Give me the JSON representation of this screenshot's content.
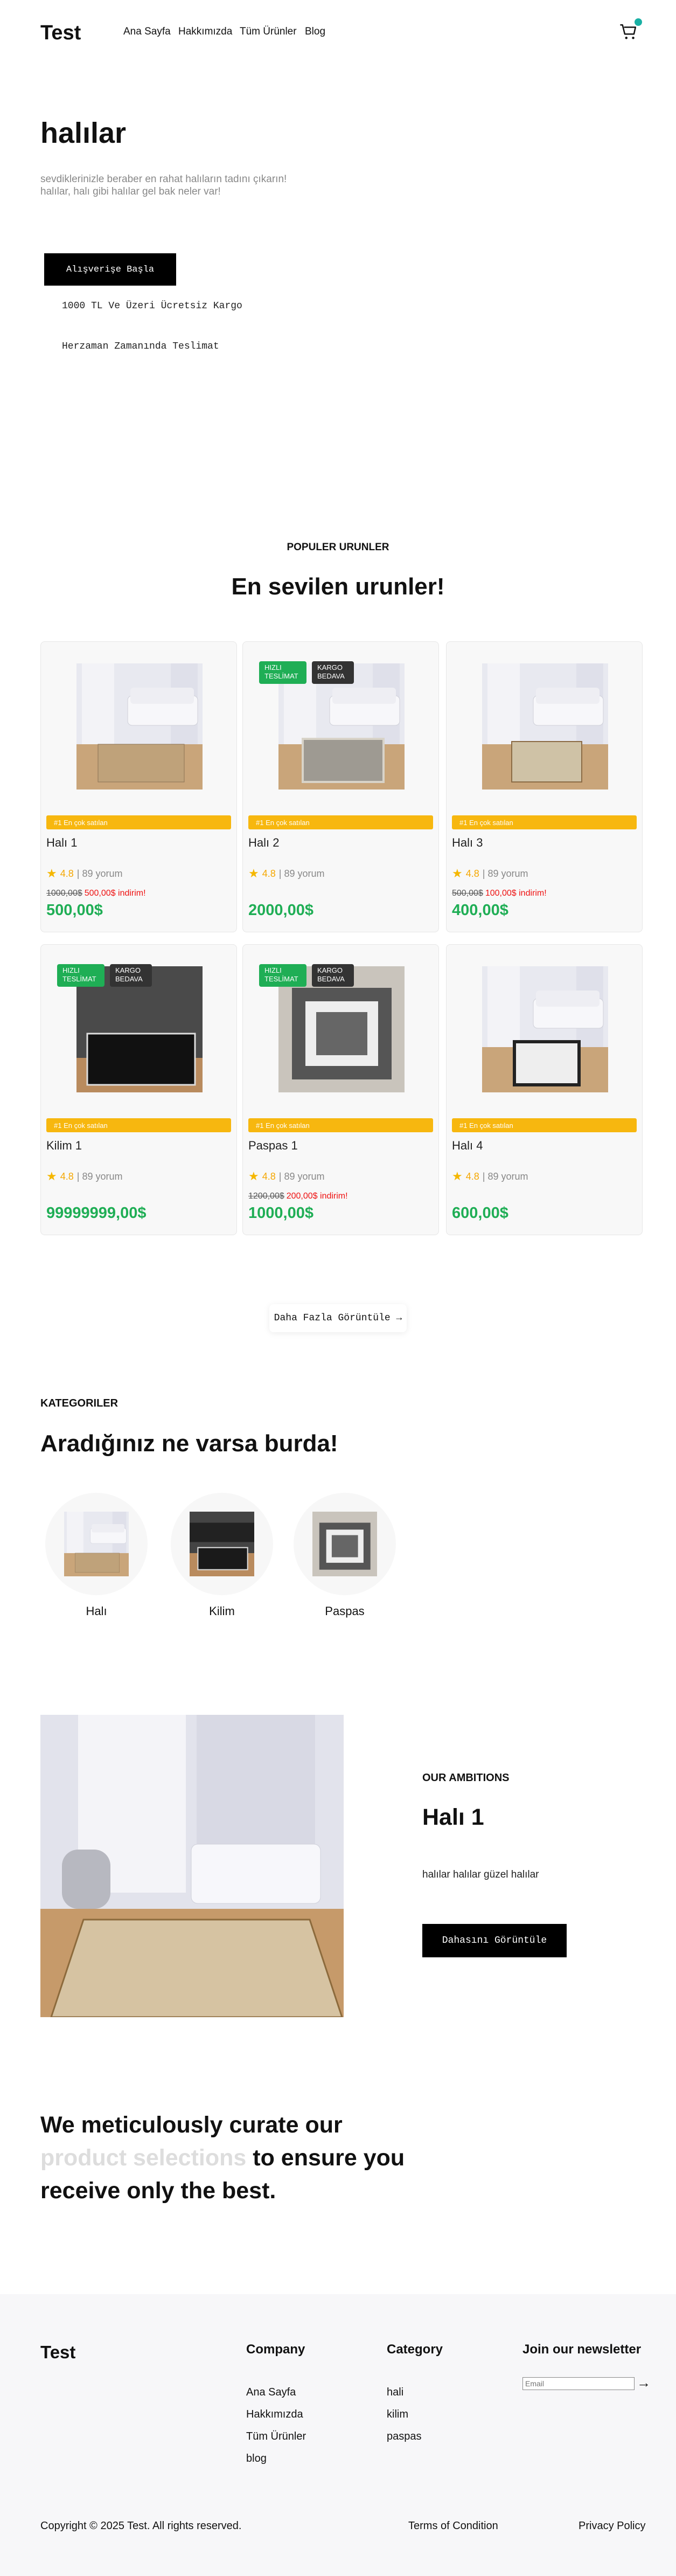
{
  "header": {
    "brand": "Test",
    "nav": [
      "Ana Sayfa",
      "Hakkımızda",
      "Tüm Ürünler",
      "Blog"
    ],
    "cart_icon": "cart-icon",
    "accent": "#19b0a4"
  },
  "hero": {
    "title": "halılar",
    "subtitle_line1": "sevdiklerinizle beraber en rahat halıların tadını çıkarın!",
    "subtitle_line2": "halılar, halı gibi halılar gel bak neler var!",
    "cta": "Alışverişe Başla",
    "perks": [
      "1000 TL Ve Üzeri Ücretsiz Kargo",
      "Herzaman Zamanında Teslimat"
    ]
  },
  "popular": {
    "eyebrow": "POPULER URUNLER",
    "title": "En sevilen urunler!",
    "best_label": "#1 En çok satılan",
    "badge_fast": "HIZLI TESLİMAT",
    "badge_free": "KARGO BEDAVA",
    "products": [
      {
        "name": "Halı 1",
        "rating": "4.8",
        "reviews": "| 89 yorum",
        "old_price": "1000,00$",
        "discount": "500,00$ indirim!",
        "price": "500,00$",
        "badges": false
      },
      {
        "name": "Halı 2",
        "rating": "4.8",
        "reviews": "| 89 yorum",
        "old_price": "",
        "discount": "",
        "price": "2000,00$",
        "badges": true
      },
      {
        "name": "Halı 3",
        "rating": "4.8",
        "reviews": "| 89 yorum",
        "old_price": "500,00$",
        "discount": "100,00$ indirim!",
        "price": "400,00$",
        "badges": false
      },
      {
        "name": "Kilim 1",
        "rating": "4.8",
        "reviews": "| 89 yorum",
        "old_price": "",
        "discount": "",
        "price": "99999999,00$",
        "badges": true
      },
      {
        "name": "Paspas 1",
        "rating": "4.8",
        "reviews": "| 89 yorum",
        "old_price": "1200,00$",
        "discount": "200,00$ indirim!",
        "price": "1000,00$",
        "badges": true
      },
      {
        "name": "Halı 4",
        "rating": "4.8",
        "reviews": "| 89 yorum",
        "old_price": "",
        "discount": "",
        "price": "600,00$",
        "badges": false
      }
    ],
    "more": "Daha Fazla Görüntüle →"
  },
  "categories": {
    "eyebrow": "KATEGORILER",
    "title": "Aradığınız ne varsa burda!",
    "items": [
      "Halı",
      "Kilim",
      "Paspas"
    ]
  },
  "ambitions": {
    "eyebrow": "OUR AMBITIONS",
    "title": "Halı 1",
    "desc": "halılar halılar güzel halılar",
    "cta": "Dahasını Görüntüle"
  },
  "curate": {
    "pre": "We meticulously curate our ",
    "highlight": "product selections",
    "post": " to ensure you receive only the best."
  },
  "footer": {
    "brand": "Test",
    "company_head": "Company",
    "company": [
      "Ana Sayfa",
      "Hakkımızda",
      "Tüm Ürünler",
      "blog"
    ],
    "category_head": "Category",
    "category": [
      "hali",
      "kilim",
      "paspas"
    ],
    "newsletter_head": "Join our newsletter",
    "email_placeholder": "Email",
    "arrow": "→",
    "copyright": "Copyright © 2025 Test. All rights reserved.",
    "terms": "Terms of Condition",
    "privacy": "Privacy Policy"
  }
}
